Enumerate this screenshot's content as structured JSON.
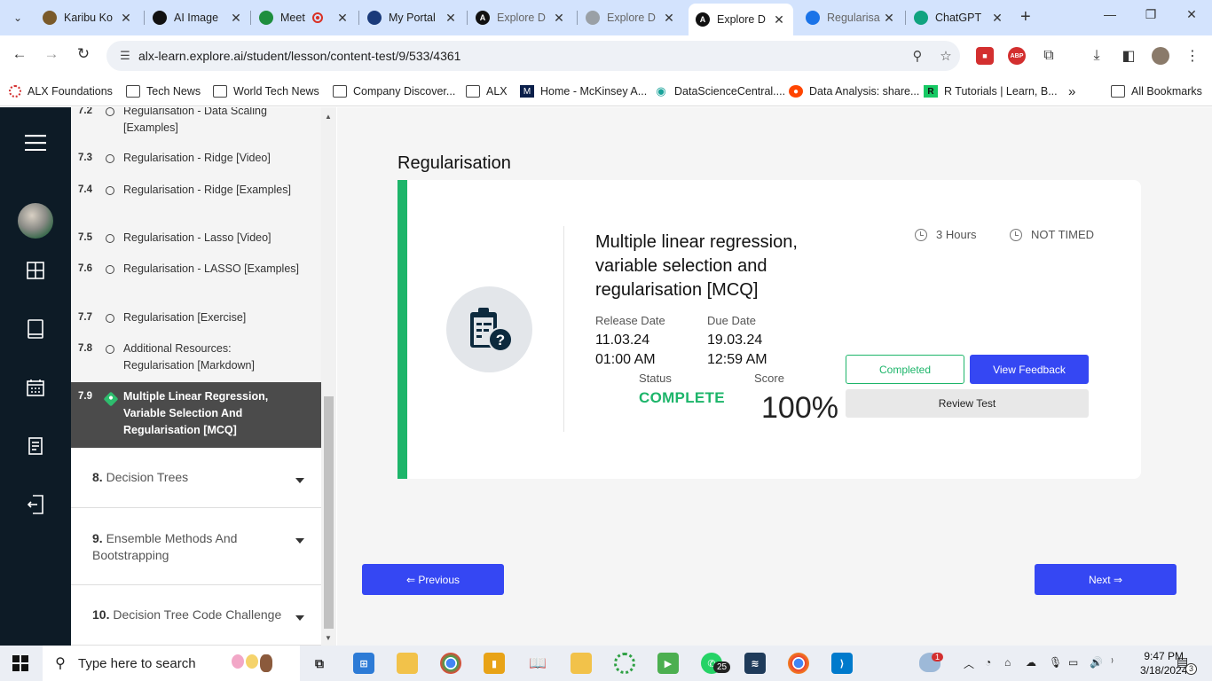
{
  "browser": {
    "tabs": [
      {
        "title": "Karibu Ko",
        "favicon_color": "#7a5a2a"
      },
      {
        "title": "AI Image",
        "favicon_color": "#111111"
      },
      {
        "title": "Meet",
        "favicon_color": "#1e8e3e"
      },
      {
        "title": "My Portal",
        "favicon_color": "#1a3a7a"
      },
      {
        "title": "Explore D",
        "favicon_color": "#111111"
      },
      {
        "title": "Explore D",
        "favicon_color": "#9aa0a6"
      },
      {
        "title": "Explore D",
        "favicon_color": "#111111",
        "active": true
      },
      {
        "title": "Regularisa",
        "favicon_color": "#1a73e8"
      },
      {
        "title": "ChatGPT",
        "favicon_color": "#10a37f"
      }
    ],
    "url": "alx-learn.explore.ai/student/lesson/content-test/9/533/4361",
    "bookmarks": [
      "ALX Foundations",
      "Tech News",
      "World Tech News",
      "Company Discover...",
      "ALX",
      "Home - McKinsey A...",
      "DataScienceCentral....",
      "Data Analysis: share...",
      "R Tutorials | Learn, B...",
      "All Bookmarks"
    ]
  },
  "sidebar": {
    "lessons": [
      {
        "num": "7.2",
        "title": "Regularisation - Data Scaling [Examples]"
      },
      {
        "num": "7.3",
        "title": "Regularisation - Ridge [Video]"
      },
      {
        "num": "7.4",
        "title": "Regularisation - Ridge [Examples]"
      },
      {
        "num": "7.5",
        "title": "Regularisation - Lasso [Video]"
      },
      {
        "num": "7.6",
        "title": "Regularisation - LASSO [Examples]"
      },
      {
        "num": "7.7",
        "title": "Regularisation [Exercise]"
      },
      {
        "num": "7.8",
        "title": "Additional Resources: Regularisation [Markdown]"
      },
      {
        "num": "7.9",
        "title": "Multiple Linear Regression, Variable Selection And Regularisation [MCQ]"
      }
    ],
    "sections": [
      {
        "num": "8.",
        "title": "Decision Trees"
      },
      {
        "num": "9.",
        "title": "Ensemble Methods And Bootstrapping"
      },
      {
        "num": "10.",
        "title": "Decision Tree Code Challenge"
      }
    ]
  },
  "main": {
    "heading": "Regularisation",
    "card": {
      "title": "Multiple linear regression, variable selection and regularisation [MCQ]",
      "duration": "3 Hours",
      "timing": "NOT TIMED",
      "release_label": "Release Date",
      "release_date": "11.03.24",
      "release_time": "01:00 AM",
      "due_label": "Due Date",
      "due_date": "19.03.24",
      "due_time": "12:59 AM",
      "status_label": "Status",
      "status": "COMPLETE",
      "score_label": "Score",
      "score": "100%",
      "completed_btn": "Completed",
      "feedback_btn": "View Feedback",
      "review_btn": "Review Test"
    },
    "prev_btn": "⇐ Previous",
    "next_btn": "Next ⇒"
  },
  "taskbar": {
    "search_placeholder": "Type here to search",
    "whatsapp_badge": "25",
    "weather_badge": "1",
    "notif_badge": "3",
    "time": "9:47 PM",
    "date": "3/18/2024"
  },
  "colors": {
    "accent": "#3547f3",
    "success": "#1db56a",
    "rail": "#0d1b26"
  }
}
